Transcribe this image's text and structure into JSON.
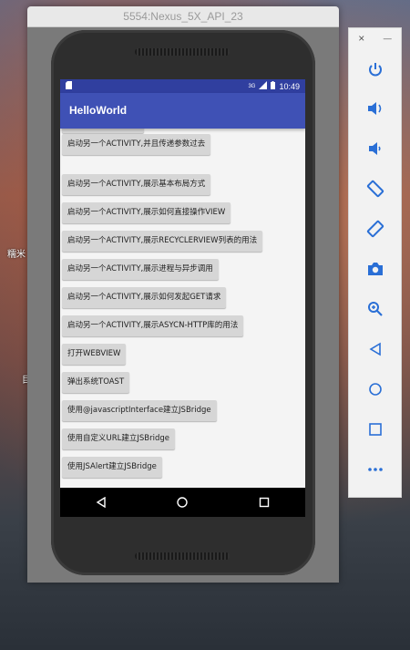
{
  "desktop": {
    "label1": "糯米",
    "label2": "目"
  },
  "emulator": {
    "title": "5554:Nexus_5X_API_23"
  },
  "status": {
    "time": "10:49",
    "network": "3G"
  },
  "app": {
    "title": "HelloWorld",
    "buttons": [
      "启动另一个ACTIVITY,并且传递参数过去",
      "启动另一个ACTIVITY,展示基本布局方式",
      "启动另一个ACTIVITY,展示如何直接操作VIEW",
      "启动另一个ACTIVITY,展示RECYCLERVIEW列表的用法",
      "启动另一个ACTIVITY,展示进程与异步调用",
      "启动另一个ACTIVITY,展示如何发起GET请求",
      "启动另一个ACTIVITY,展示ASYCN-HTTP库的用法",
      "打开WEBVIEW",
      "弹出系统TOAST",
      "使用@javascriptInterface建立JSBridge",
      "使用自定义URL建立JSBridge",
      "使用JSAlert建立JSBridge"
    ]
  },
  "toolbar": {
    "close": "×",
    "minimize": "—",
    "icons": [
      "power-icon",
      "volume-up-icon",
      "volume-down-icon",
      "rotate-left-icon",
      "rotate-right-icon",
      "camera-icon",
      "zoom-icon",
      "back-icon",
      "home-icon",
      "overview-icon",
      "more-icon"
    ]
  },
  "colors": {
    "primary": "#3f51b5",
    "primary_dark": "#303f9f",
    "toolbar_icon": "#2a6fd6"
  }
}
